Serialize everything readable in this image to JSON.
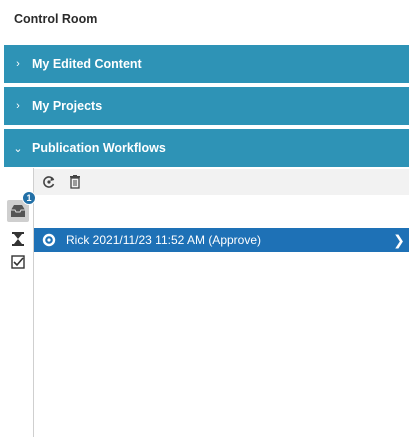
{
  "app": {
    "title": "Control Room"
  },
  "sections": [
    {
      "label": "My Edited Content",
      "chevron": "›"
    },
    {
      "label": "My Projects",
      "chevron": "›"
    },
    {
      "label": "Publication Workflows",
      "chevron": "⌄"
    }
  ],
  "rail": {
    "items": [
      {
        "icon": "inbox-icon",
        "badge": "1",
        "active": true
      },
      {
        "icon": "hourglass-icon",
        "active": false
      },
      {
        "icon": "checkbox-icon",
        "active": false
      }
    ]
  },
  "toolbar": {
    "items": [
      {
        "icon": "refresh-icon"
      },
      {
        "icon": "trash-icon"
      }
    ]
  },
  "workflow_rows": [
    {
      "text": "Rick 2021/11/23 11:52 AM (Approve)",
      "icon": "workflow-status-icon"
    }
  ],
  "colors": {
    "section_bg": "#2e93b6",
    "selected_row": "#1e71b6",
    "badge": "#2270a7"
  }
}
